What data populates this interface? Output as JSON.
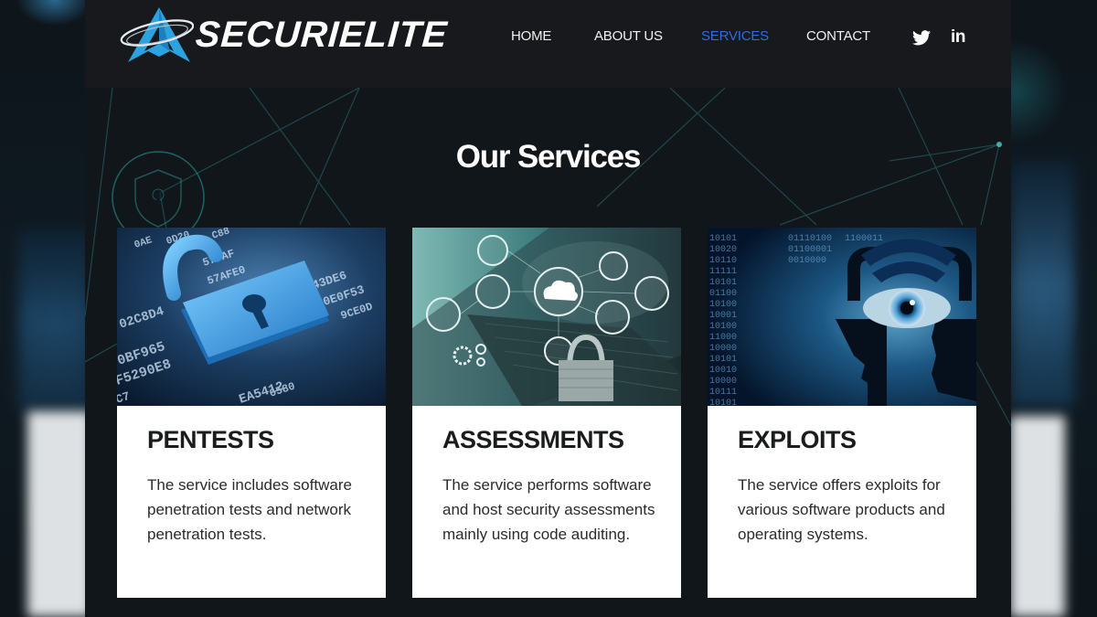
{
  "brand": {
    "name": "SECURIELITE",
    "logo_icon": "a-arrow-orbit-logo",
    "accent_color": "#2aa3e0"
  },
  "nav": {
    "items": [
      {
        "label": "HOME",
        "active": false
      },
      {
        "label": "ABOUT US",
        "active": false
      },
      {
        "label": "SERVICES",
        "active": true
      },
      {
        "label": "CONTACT",
        "active": false
      }
    ],
    "active_color": "#2b6ee0",
    "social": [
      {
        "name": "twitter",
        "icon": "twitter-icon"
      },
      {
        "name": "linkedin",
        "icon": "linkedin-icon",
        "glyph": "in"
      }
    ]
  },
  "main": {
    "title": "Our Services",
    "cards": [
      {
        "title": "PENTESTS",
        "description": "The service includes software penetration tests and network penetration tests.",
        "image": "open-padlock-on-hex-code-image",
        "image_text": [
          "0AE",
          "0D20",
          "C88",
          "57DAF",
          "57AFE0",
          "0343DE6",
          "680E0F53",
          "9CE0D",
          "02C8D4",
          "0BF965",
          "F5290E8",
          "EA5412",
          "6580",
          "C7"
        ]
      },
      {
        "title": "ASSESSMENTS",
        "description": "The service performs software and host security assessments mainly using code auditing.",
        "image": "laptop-cloud-network-padlock-image"
      },
      {
        "title": "EXPLOITS",
        "description": "The service offers exploits for various software products and operating systems.",
        "image": "eye-padlock-binary-image",
        "image_text": [
          "10101",
          "10020",
          "10110",
          "11111",
          "10101",
          "01100",
          "10100",
          "10001",
          "10100",
          "11000",
          "10000",
          "10101",
          "10010",
          "10000",
          "10111",
          "10101",
          "01110100",
          "01100001",
          "0010000",
          "1100011"
        ]
      }
    ]
  }
}
